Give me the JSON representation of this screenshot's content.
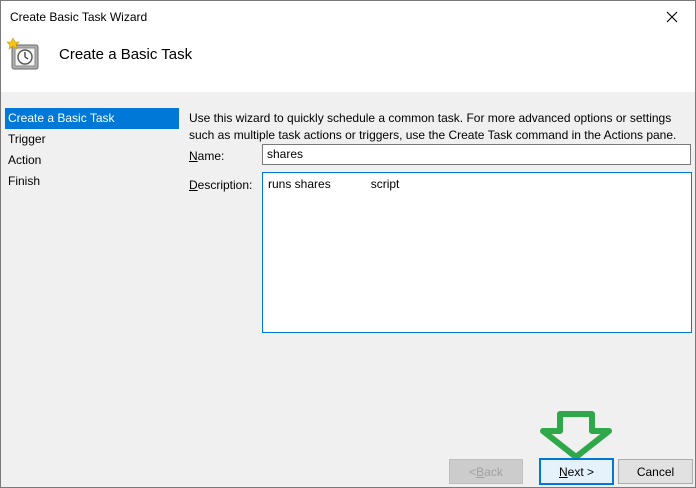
{
  "window": {
    "title": "Create Basic Task Wizard",
    "close_glyph": "✕"
  },
  "header": {
    "title": "Create a Basic Task",
    "icon": "task-scheduler-clock-icon"
  },
  "sidebar": {
    "steps": [
      {
        "label": "Create a Basic Task",
        "active": true
      },
      {
        "label": "Trigger",
        "active": false
      },
      {
        "label": "Action",
        "active": false
      },
      {
        "label": "Finish",
        "active": false
      }
    ]
  },
  "main": {
    "intro": "Use this wizard to quickly schedule a common task.  For more advanced options or settings such as multiple task actions or triggers, use the Create Task command in the Actions pane.",
    "name_label_accel": "N",
    "name_label_rest": "ame:",
    "name_value": "shares",
    "description_label_accel": "D",
    "description_label_rest": "escription:",
    "description_value": "runs shares            script"
  },
  "buttons": {
    "back_accel": "B",
    "back_prefix": "< ",
    "back_rest": "ack",
    "next_accel": "N",
    "next_rest": "ext >",
    "cancel": "Cancel"
  },
  "colors": {
    "accent": "#0078d7",
    "arrow": "#2fa84a"
  }
}
